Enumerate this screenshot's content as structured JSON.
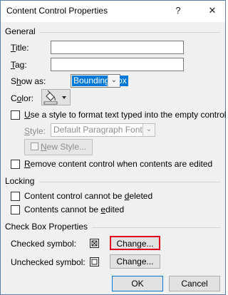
{
  "title": "Content Control Properties",
  "titlebar": {
    "help_glyph": "?",
    "close_glyph": "✕"
  },
  "general": {
    "header": "General",
    "title_label_u": "T",
    "title_label_rest": "itle:",
    "title_value": "",
    "tag_label_u": "T",
    "tag_label_rest": "ag:",
    "tag_value": "",
    "show_as_label_pre": "S",
    "show_as_label_u": "h",
    "show_as_label_rest": "ow as:",
    "show_as_value": "Bounding Box",
    "color_label_pre": "C",
    "color_label_u": "o",
    "color_label_rest": "lor:",
    "use_style_u": "U",
    "use_style_rest": "se a style to format text typed into the empty control",
    "style_label_u": "S",
    "style_label_rest": "tyle:",
    "style_value": "Default Paragraph Font",
    "new_style_label_u": "N",
    "new_style_label_rest": "ew Style...",
    "remove_label_u": "R",
    "remove_label_rest": "emove content control when contents are edited"
  },
  "locking": {
    "header": "Locking",
    "cannot_delete_pre": "Content control cannot be ",
    "cannot_delete_u": "d",
    "cannot_delete_rest": "eleted",
    "cannot_edit_pre": "Contents cannot be ",
    "cannot_edit_u": "e",
    "cannot_edit_rest": "dited"
  },
  "checkbox": {
    "header": "Check Box Properties",
    "checked_label": "Checked symbol:",
    "checked_symbol": "☒",
    "unchecked_label": "Unchecked symbol:",
    "unchecked_symbol": "☐",
    "change_label": "Change..."
  },
  "footer": {
    "ok_label": "OK",
    "cancel_label": "Cancel"
  },
  "colors": {
    "highlight": "#0078d7",
    "red_outline": "#e0001b",
    "dialog_bg": "#f0f0f0"
  }
}
